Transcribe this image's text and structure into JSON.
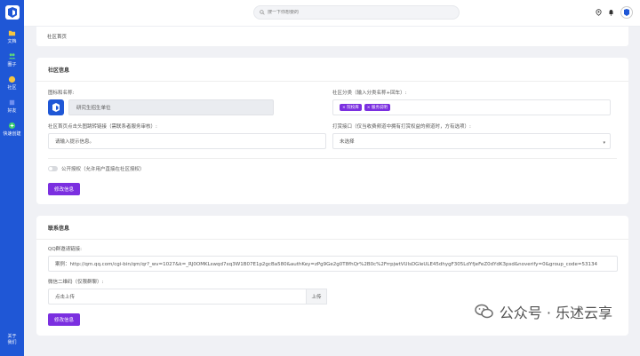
{
  "sidebar": {
    "items": [
      {
        "label": "文档"
      },
      {
        "label": "圈子"
      },
      {
        "label": "社区"
      },
      {
        "label": "好友"
      },
      {
        "label": "快速创建"
      }
    ],
    "about": [
      "关于",
      "我们"
    ]
  },
  "search": {
    "placeholder": "搜一下你想要的"
  },
  "breadcrumb": {
    "text": "社区首页"
  },
  "community_info": {
    "title": "社区信息",
    "name_label": "图标和名称:",
    "name_value": "研究生招生单位",
    "category_label": "社区分类（输入分类名称+回车）:",
    "tags": [
      "院校库",
      "服务说明"
    ],
    "link_label": "社区首页点击头图跳转链接（需联系者服务审核）:",
    "link_placeholder": "请输入提示信息。",
    "reward_label": "打赏接口（仅当收费频道中拥有打赏权益的频道时，方有选项）:",
    "reward_value": "未选择",
    "toggle_label": "公开授权（允许用户直接在社区授权）",
    "button": "修改信息"
  },
  "contact_info": {
    "title": "联系信息",
    "qq_label": "QQ群邀请链接:",
    "qq_value": "案例：http://qm.qq.com/cgi-bin/qm/qr?_wv=1027&k=_RJ0OMKLswqd7xq3W1B07E1p2gcBa580&authKey=zPg9Ge2g0T8fhQr%2B0c%2FrrpjwtVUlsDGleULE45dhygF305LdYfjeFeZ0dYdK3psd&noverify=0&group_code=53134",
    "qr_label": "微信二维码（仅限群聊）:",
    "qr_placeholder": "点击上传",
    "upload_button": "上传",
    "button": "修改信息"
  },
  "watermark": {
    "text": "公众号 · 乐述云享"
  },
  "colors": {
    "sidebar": "#1f57d6",
    "accent": "#7b2fe0",
    "background": "#f0f1f5"
  }
}
